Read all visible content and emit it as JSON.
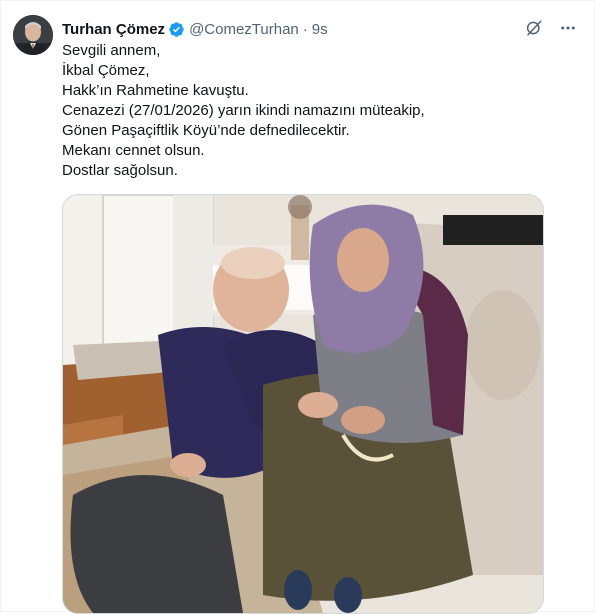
{
  "tweet": {
    "author_name": "Turhan Çömez",
    "handle": "@ComezTurhan",
    "separator": "·",
    "time": "9s",
    "verified": true,
    "lines": [
      "Sevgili annem,",
      "İkbal Çömez,",
      "Hakk’ın Rahmetine kavuştu.",
      "Cenazezi (27/01/2026) yarın ikindi namazını müteakip,",
      "Gönen Paşaçiftlik Köyü’nde defnedilecektir.",
      "Mekanı cennet olsun.",
      "Dostlar sağolsun."
    ],
    "icons": {
      "verified": "verified-badge-icon",
      "grok": "grok-icon",
      "more": "more-icon"
    },
    "colors": {
      "verified": "#1d9bf0",
      "secondary_text": "#536471",
      "border": "#cfd9de"
    }
  }
}
